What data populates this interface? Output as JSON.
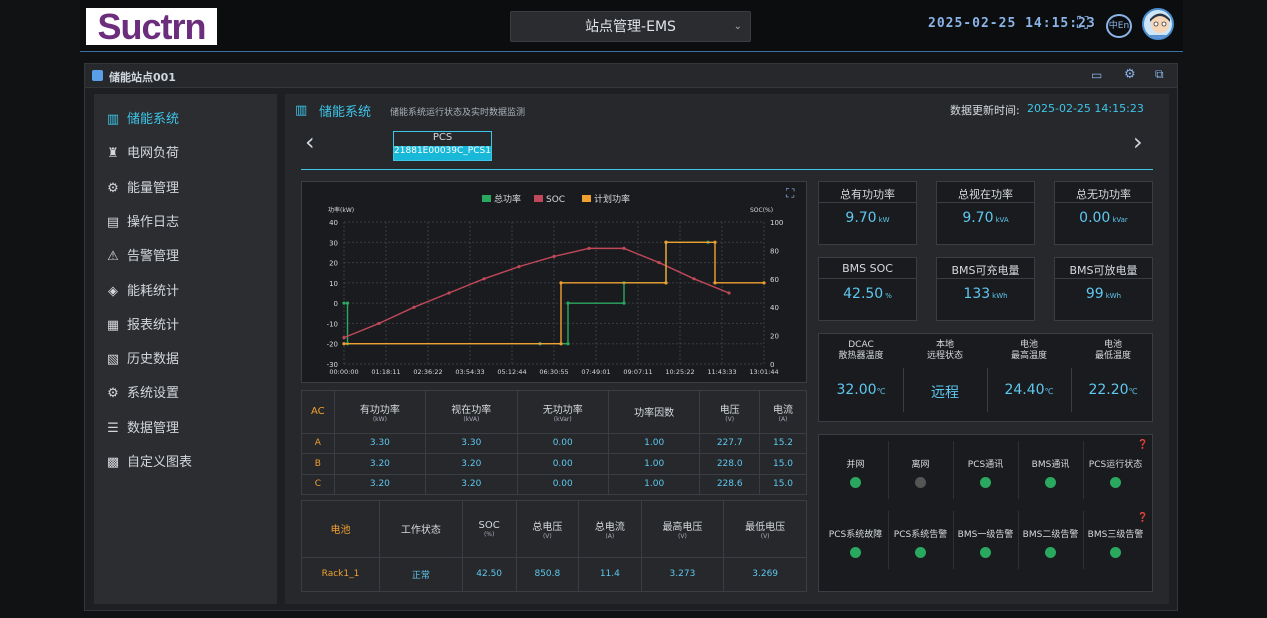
{
  "header": {
    "logo_text": "Suctrn",
    "site_selector": "站点管理-EMS",
    "datetime": "2025-02-25  14:15:23",
    "lang_icon": "中En"
  },
  "panel": {
    "title": "储能站点001"
  },
  "sidebar": {
    "items": [
      {
        "label": "储能系统",
        "icon": "battery-icon",
        "active": true
      },
      {
        "label": "电网负荷",
        "icon": "tower-icon"
      },
      {
        "label": "能量管理",
        "icon": "energy-icon"
      },
      {
        "label": "操作日志",
        "icon": "log-icon"
      },
      {
        "label": "告警管理",
        "icon": "warning-icon"
      },
      {
        "label": "能耗统计",
        "icon": "consumption-icon"
      },
      {
        "label": "报表统计",
        "icon": "report-icon"
      },
      {
        "label": "历史数据",
        "icon": "history-icon"
      },
      {
        "label": "系统设置",
        "icon": "gear-icon"
      },
      {
        "label": "数据管理",
        "icon": "database-icon"
      },
      {
        "label": "自定义图表",
        "icon": "chart-icon"
      }
    ]
  },
  "main": {
    "title": "储能系统",
    "subtitle": "储能系统运行状态及实时数据监测",
    "update_label": "数据更新时间:",
    "update_time": "2025-02-25 14:15:23",
    "device_type": "PCS",
    "device_id": "21881E00039C_PCS1"
  },
  "kpis": [
    {
      "label": "总有功功率",
      "value": "9.70",
      "unit": "kW"
    },
    {
      "label": "总视在功率",
      "value": "9.70",
      "unit": "kVA"
    },
    {
      "label": "总无功功率",
      "value": "0.00",
      "unit": "kVar"
    },
    {
      "label": "BMS SOC",
      "value": "42.50",
      "unit": "%"
    },
    {
      "label": "BMS可充电量",
      "value": "133",
      "unit": "kWh"
    },
    {
      "label": "BMS可放电量",
      "value": "99",
      "unit": "kWh"
    }
  ],
  "temps": [
    {
      "label1": "DCAC",
      "label2": "散热器温度",
      "value": "32.00",
      "unit": "℃"
    },
    {
      "label1": "本地",
      "label2": "远程状态",
      "value": "远程",
      "unit": ""
    },
    {
      "label1": "电池",
      "label2": "最高温度",
      "value": "24.40",
      "unit": "℃"
    },
    {
      "label1": "电池",
      "label2": "最低温度",
      "value": "22.20",
      "unit": "℃"
    }
  ],
  "ac_table": {
    "headers": [
      {
        "t": "AC",
        "u": ""
      },
      {
        "t": "有功功率",
        "u": "(kW)"
      },
      {
        "t": "视在功率",
        "u": "(kVA)"
      },
      {
        "t": "无功功率",
        "u": "(kVar)"
      },
      {
        "t": "功率因数",
        "u": ""
      },
      {
        "t": "电压",
        "u": "(V)"
      },
      {
        "t": "电流",
        "u": "(A)"
      }
    ],
    "rows": [
      [
        "A",
        "3.30",
        "3.30",
        "0.00",
        "1.00",
        "227.7",
        "15.2"
      ],
      [
        "B",
        "3.20",
        "3.20",
        "0.00",
        "1.00",
        "228.0",
        "15.0"
      ],
      [
        "C",
        "3.20",
        "3.20",
        "0.00",
        "1.00",
        "228.6",
        "15.0"
      ]
    ]
  },
  "battery_table": {
    "headers": [
      {
        "t": "电池",
        "u": ""
      },
      {
        "t": "工作状态",
        "u": ""
      },
      {
        "t": "SOC",
        "u": "(%)"
      },
      {
        "t": "总电压",
        "u": "(V)"
      },
      {
        "t": "总电流",
        "u": "(A)"
      },
      {
        "t": "最高电压",
        "u": "(V)"
      },
      {
        "t": "最低电压",
        "u": "(V)"
      }
    ],
    "rows": [
      [
        "Rack1_1",
        "正常",
        "42.50",
        "850.8",
        "11.4",
        "3.273",
        "3.269"
      ]
    ]
  },
  "status": {
    "row1": [
      {
        "label": "并网",
        "on": true
      },
      {
        "label": "离网",
        "on": false
      },
      {
        "label": "PCS通讯",
        "on": true
      },
      {
        "label": "BMS通讯",
        "on": true
      },
      {
        "label": "PCS运行状态",
        "on": true
      }
    ],
    "row2": [
      {
        "label": "PCS系统故障",
        "on": true
      },
      {
        "label": "PCS系统告警",
        "on": true
      },
      {
        "label": "BMS一级告警",
        "on": true
      },
      {
        "label": "BMS二级告警",
        "on": true
      },
      {
        "label": "BMS三级告警",
        "on": true
      }
    ]
  },
  "chart_data": {
    "type": "line",
    "legend": [
      "总功率",
      "SOC",
      "计划功率"
    ],
    "ylabel_left": "功率(kW)",
    "ylabel_right": "SOC(%)",
    "y_left_ticks": [
      "40",
      "30",
      "20",
      "10",
      "0",
      "-10",
      "-20",
      "-30"
    ],
    "y_right_ticks": [
      "100",
      "80",
      "60",
      "40",
      "20",
      "0"
    ],
    "ylim_left": [
      -30,
      40
    ],
    "ylim_right": [
      0,
      100
    ],
    "x_ticks": [
      "00:00:00",
      "01:18:11",
      "02:36:22",
      "03:54:33",
      "05:12:44",
      "06:30:55",
      "07:49:01",
      "09:07:11",
      "10:25:22",
      "11:43:33",
      "13:01:44"
    ],
    "colors": {
      "total": "#2aa860",
      "soc": "#c0485a",
      "plan": "#f0a030"
    },
    "series": [
      {
        "name": "总功率",
        "axis": "left",
        "x": [
          0,
          0.05,
          0.05,
          2.8,
          2.8,
          3.2,
          3.2,
          4.0,
          4.0,
          4.6,
          4.6,
          5.2
        ],
        "values": [
          0,
          0,
          -20,
          -20,
          -20,
          -20,
          0,
          0,
          10,
          10,
          30,
          30
        ]
      },
      {
        "name": "SOC",
        "axis": "left",
        "x": [
          0,
          0.5,
          1.0,
          1.5,
          2.0,
          2.5,
          3.0,
          3.5,
          4.0,
          4.5,
          5.0,
          5.5
        ],
        "values": [
          -17,
          -10,
          -2,
          5,
          12,
          18,
          23,
          27,
          27,
          20,
          12,
          5
        ]
      },
      {
        "name": "计划功率",
        "axis": "left",
        "x": [
          0,
          3.1,
          3.1,
          4.6,
          4.6,
          5.3,
          5.3,
          6.0
        ],
        "values": [
          -20,
          -20,
          10,
          10,
          30,
          30,
          10,
          10
        ]
      }
    ]
  }
}
